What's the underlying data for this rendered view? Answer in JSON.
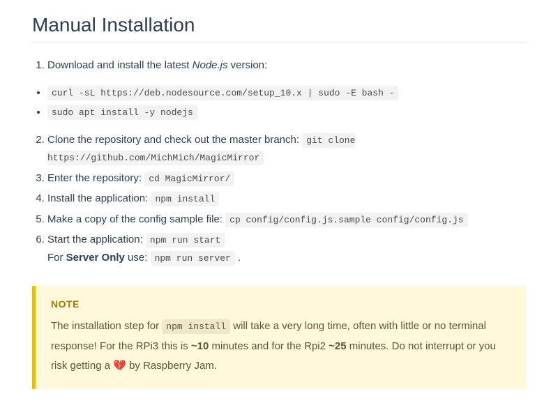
{
  "heading": "Manual Installation",
  "step1": {
    "text_before": "Download and install the latest ",
    "em": "Node.js",
    "text_after": " version:"
  },
  "commands": [
    "curl -sL https://deb.nodesource.com/setup_10.x | sudo -E bash -",
    "sudo apt install -y nodejs"
  ],
  "step2": {
    "text": "Clone the repository and check out the master branch: ",
    "code": "git clone https://github.com/MichMich/MagicMirror"
  },
  "step3": {
    "text": "Enter the repository: ",
    "code": "cd MagicMirror/"
  },
  "step4": {
    "text": "Install the application: ",
    "code": "npm install"
  },
  "step5": {
    "text": "Make a copy of the config sample file: ",
    "code": "cp config/config.js.sample config/config.js"
  },
  "step6": {
    "line1_text": "Start the application: ",
    "line1_code": "npm run start",
    "line2_text_before": "For ",
    "line2_strong": "Server Only",
    "line2_text_after": " use: ",
    "line2_code": "npm run server",
    "line2_end": " ."
  },
  "note": {
    "title": "NOTE",
    "p1_before": "The installation step for ",
    "p1_code": "npm install",
    "p1_after": " will take a very long time, often with little or no terminal response! For the RPi3 this is ",
    "p1_strong1": "~10",
    "p1_mid": " minutes and for the Rpi2 ",
    "p1_strong2": "~25",
    "p1_after2": " minutes. Do not interrupt or you risk getting a ",
    "p1_emoji": "💔",
    "p1_end": " by Raspberry Jam."
  }
}
